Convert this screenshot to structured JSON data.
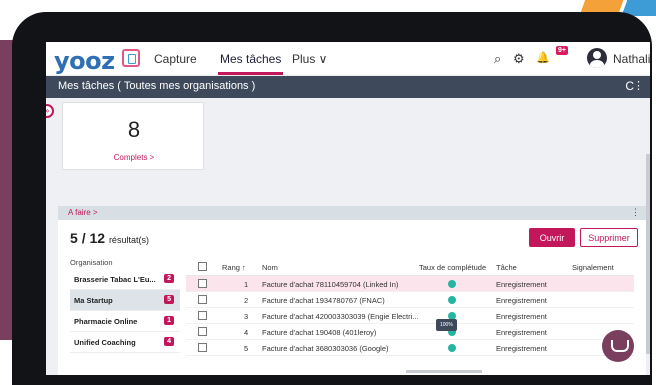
{
  "app": {
    "logo_text": "yooz"
  },
  "nav": {
    "capture": "Capture",
    "taches": "Mes tâches",
    "plus": "Plus ∨"
  },
  "header": {
    "search_icon": "⌕",
    "gear_icon": "⚙",
    "bell_icon": "🔔",
    "notif_badge": "9+",
    "user_name": "Nathalie",
    "user_caret": "∨"
  },
  "band": {
    "title": "Mes tâches ( Toutes mes organisations )",
    "refresh": "C",
    "menu": "⋮"
  },
  "side_toggle": "»",
  "stat": {
    "value": "8",
    "link": "Complets >"
  },
  "section": {
    "label": "A faire >",
    "menu": "⋮"
  },
  "results": {
    "current": "5",
    "total": "12",
    "suffix": "résultat(s)"
  },
  "actions": {
    "ouvrir": "Ouvrir",
    "supprimer": "Supprimer"
  },
  "organisations": {
    "title": "Organisation",
    "items": [
      {
        "name": "Brasserie Tabac L'Eu...",
        "count": "2"
      },
      {
        "name": "Ma Startup",
        "count": "5"
      },
      {
        "name": "Pharmacie Online",
        "count": "1"
      },
      {
        "name": "Unified Coaching",
        "count": "4"
      }
    ]
  },
  "table": {
    "columns": {
      "rang": "Rang ↑",
      "nom": "Nom",
      "taux": "Taux de complétude",
      "tache": "Tâche",
      "signalement": "Signalement"
    },
    "rows": [
      {
        "rang": "1",
        "nom": "Facture d'achat 78110459704 (Linked In)",
        "tache": "Enregistrement"
      },
      {
        "rang": "2",
        "nom": "Facture d'achat 1934780767 (FNAC)",
        "tache": "Enregistrement"
      },
      {
        "rang": "3",
        "nom": "Facture d'achat 420003303039 (Engie Electri...",
        "tache": "Enregistrement"
      },
      {
        "rang": "4",
        "nom": "Facture d'achat 190408 (401leroy)",
        "tache": "Enregistrement"
      },
      {
        "rang": "5",
        "nom": "Facture d'achat 3680303036 (Google)",
        "tache": "Enregistrement"
      }
    ],
    "tooltip": "100%"
  },
  "colors": {
    "accent": "#c2185b",
    "band": "#3e4a5c",
    "completion": "#26b5a3",
    "brand_blue": "#2f6fb6"
  }
}
